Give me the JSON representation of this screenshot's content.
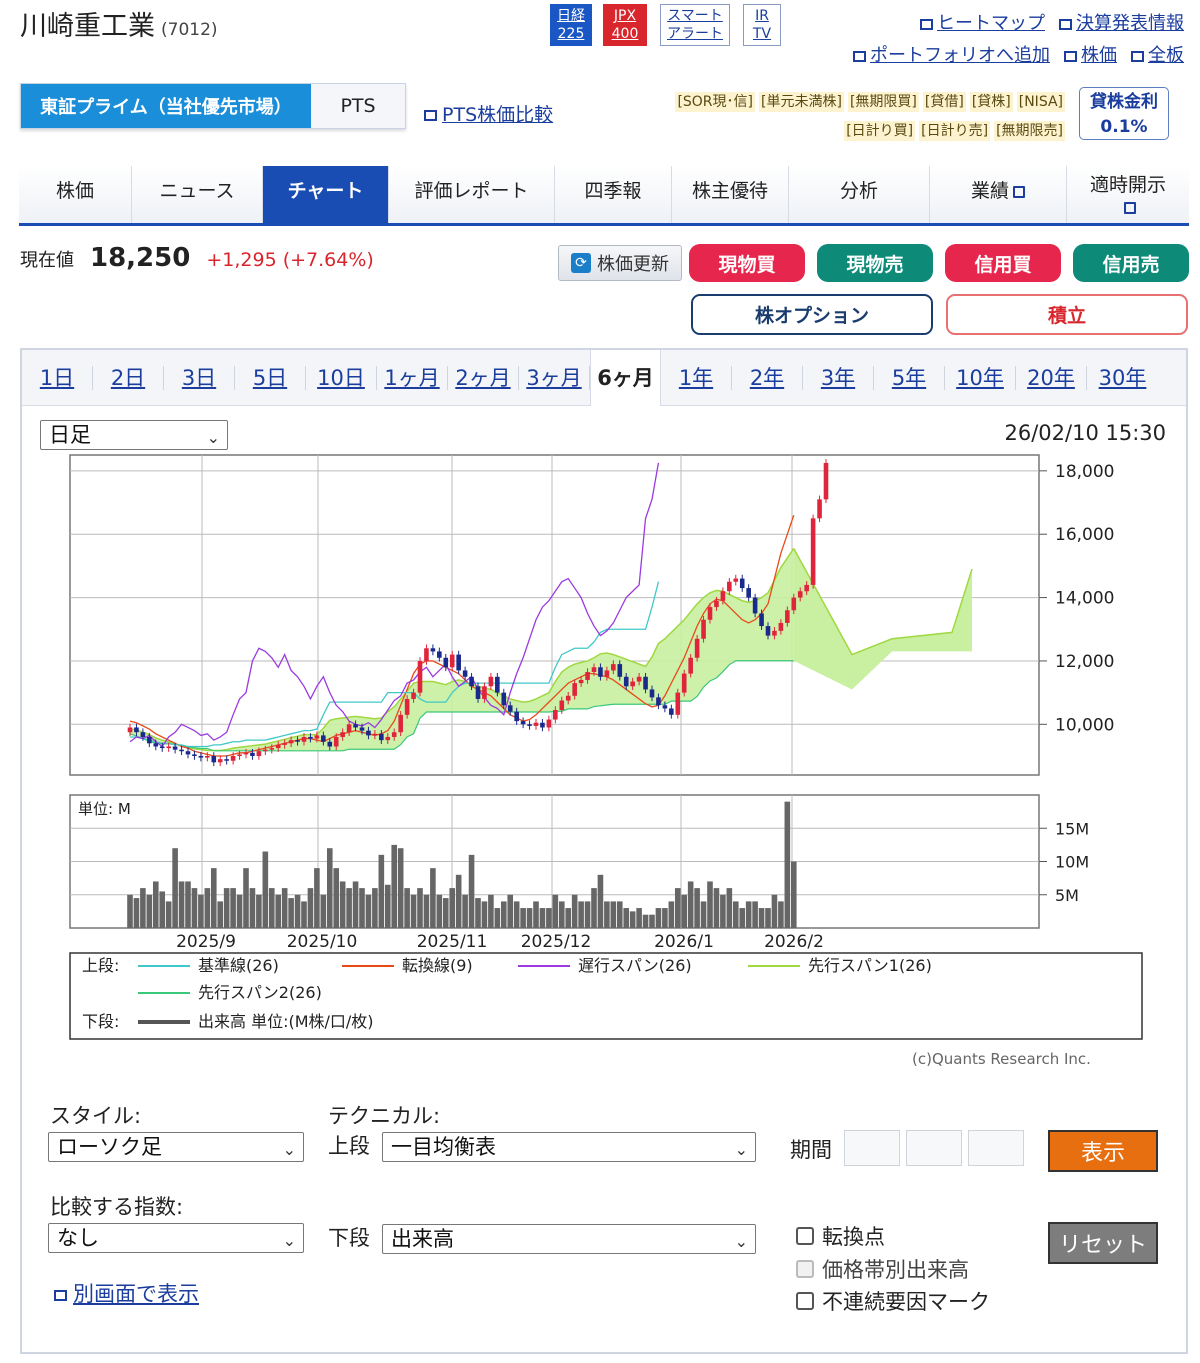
{
  "header": {
    "company_name": "川崎重工業",
    "code": "(7012)",
    "badges": [
      {
        "line1": "日経",
        "line2": "225"
      },
      {
        "line1": "JPX",
        "line2": "400"
      },
      {
        "line1": "スマート",
        "line2": "アラート"
      },
      {
        "line1": "IR",
        "line2": "TV"
      }
    ],
    "links_row1": [
      "ヒートマップ",
      "決算発表情報"
    ],
    "links_row2": [
      "ポートフォリオへ追加",
      "株価",
      "全板"
    ]
  },
  "market": {
    "active_tab": "東証プライム（当社優先市場）",
    "pts_tab": "PTS",
    "pts_compare": "PTS株価比較",
    "tags_row1": [
      "[SOR現･信]",
      "[単元未満株]",
      "[無期限買]",
      "[貸借]",
      "[貸株]",
      "[NISA]"
    ],
    "tags_row2": [
      "[日計り買]",
      "[日計り売]",
      "[無期限売]"
    ],
    "lending_label": "貸株金利",
    "lending_rate": "0.1%"
  },
  "nav": {
    "items": [
      {
        "label": "株価"
      },
      {
        "label": "ニュース"
      },
      {
        "label": "チャート",
        "active": true
      },
      {
        "label": "評価レポート"
      },
      {
        "label": "四季報"
      },
      {
        "label": "株主優待"
      },
      {
        "label": "分析"
      },
      {
        "label": "業績",
        "ext": true
      },
      {
        "label": "適時開示",
        "ext": true
      }
    ]
  },
  "price": {
    "label": "現在値",
    "value": "18,250",
    "change": "+1,295 (+7.64%)",
    "refresh_label": "株価更新",
    "buttons": [
      "現物買",
      "現物売",
      "信用買",
      "信用売"
    ],
    "option_label": "株オプション",
    "tsumitate_label": "積立"
  },
  "period_tabs": [
    "1日",
    "2日",
    "3日",
    "5日",
    "10日",
    "1ヶ月",
    "2ヶ月",
    "3ヶ月",
    "6ヶ月",
    "1年",
    "2年",
    "3年",
    "5年",
    "10年",
    "20年",
    "30年"
  ],
  "active_period": "6ヶ月",
  "chart_controls": {
    "interval": "日足",
    "timestamp": "26/02/10 15:30"
  },
  "chart_data": {
    "type": "candlestick",
    "y_ticks": [
      "18,000",
      "16,000",
      "14,000",
      "12,000",
      "10,000"
    ],
    "ylim": [
      8400,
      18500
    ],
    "x_labels": [
      "2025/9",
      "2025/10",
      "2025/11",
      "2025/12",
      "2026/1",
      "2026/2"
    ],
    "volume_unit": "単位: M",
    "volume_ticks": [
      "15M",
      "10M",
      "5M"
    ],
    "close": [
      9900,
      9750,
      9600,
      9400,
      9300,
      9250,
      9300,
      9200,
      9150,
      9050,
      9000,
      8950,
      9000,
      8800,
      8900,
      8850,
      9000,
      9050,
      9100,
      9000,
      9150,
      9200,
      9250,
      9350,
      9400,
      9500,
      9450,
      9600,
      9550,
      9650,
      9450,
      9300,
      9600,
      9750,
      10000,
      9900,
      9800,
      9650,
      9700,
      9500,
      9600,
      9750,
      10300,
      10800,
      11000,
      12000,
      12400,
      12300,
      12100,
      11800,
      12200,
      11700,
      11500,
      11200,
      10800,
      11200,
      11500,
      11000,
      10600,
      10400,
      10100,
      10000,
      9950,
      10050,
      9900,
      10150,
      10450,
      10750,
      10900,
      11300,
      11400,
      11650,
      11800,
      11500,
      11700,
      11900,
      11500,
      11200,
      11350,
      11500,
      11100,
      10850,
      10600,
      10500,
      10300,
      11000,
      11600,
      12100,
      12700,
      13300,
      13700,
      13900,
      14200,
      14500,
      14600,
      14300,
      14000,
      13500,
      13100,
      12800,
      12950,
      13200,
      13600,
      14000,
      14200,
      14400,
      16500,
      17100,
      18250
    ],
    "tenkan": [
      10100,
      10050,
      9950,
      9850,
      9700,
      9600,
      9500,
      9400,
      9300,
      9250,
      9150,
      9100,
      9050,
      9000,
      9000,
      9000,
      9050,
      9100,
      9100,
      9150,
      9200,
      9250,
      9300,
      9350,
      9400,
      9450,
      9500,
      9550,
      9550,
      9500,
      9450,
      9550,
      9650,
      9700,
      9750,
      9800,
      9750,
      9700,
      9650,
      9700,
      9800,
      10100,
      10600,
      11100,
      11600,
      11900,
      12000,
      12000,
      11900,
      11800,
      11700,
      11600,
      11400,
      11200,
      11100,
      11000,
      10900,
      10700,
      10500,
      10300,
      10200,
      10100,
      10150,
      10300,
      10500,
      10700,
      10900,
      11100,
      11300,
      11400,
      11500,
      11600,
      11600,
      11550,
      11500,
      11400,
      11250,
      11100,
      10950,
      10800,
      10650,
      10550,
      10600,
      10900,
      11300,
      11700,
      12100,
      12600,
      13100,
      13500,
      13800,
      13950,
      13900,
      13700,
      13500,
      13300,
      13200,
      13300,
      13500,
      13800,
      14600,
      15400,
      16000,
      16600
    ],
    "kijun": [
      9600,
      9600,
      9550,
      9500,
      9450,
      9400,
      9400,
      9350,
      9350,
      9300,
      9300,
      9300,
      9300,
      9350,
      9350,
      9400,
      9450,
      9450,
      9500,
      9500,
      9500,
      9500,
      9550,
      9600,
      9650,
      9700,
      9750,
      9800,
      9800,
      9850,
      10300,
      10700,
      10700,
      10700,
      10700,
      10700,
      10700,
      10700,
      10700,
      10700,
      11000,
      11000,
      11000,
      11000,
      11000,
      10800,
      10700,
      10700,
      10700,
      10700,
      11000,
      11200,
      11300,
      11300,
      11300,
      11300,
      11300,
      11300,
      11300,
      11300,
      11300,
      11300,
      11300,
      11300,
      11300,
      11300,
      11800,
      12200,
      12300,
      12400,
      12400,
      12400,
      12600,
      12900,
      13000,
      13000,
      13000,
      13000,
      13000,
      13000,
      13000,
      13700,
      14500
    ],
    "chikou_note": "遅行スパン(26)",
    "volumes": [
      5,
      4.5,
      6,
      5,
      7,
      5.5,
      4,
      12,
      7,
      7,
      6,
      5,
      6,
      9,
      4,
      6,
      6,
      5,
      9,
      6,
      5,
      11.5,
      6,
      5,
      6,
      4.5,
      5,
      4,
      6,
      9,
      5,
      12,
      9,
      7,
      6,
      7,
      6,
      5,
      6,
      11,
      6.5,
      12.5,
      12,
      6,
      5,
      6,
      5,
      9,
      5,
      4.5,
      6,
      8,
      5,
      11,
      4.5,
      4,
      5,
      3,
      4,
      5,
      4,
      3,
      3,
      4,
      3,
      3,
      5,
      4,
      3,
      5,
      4,
      4,
      6,
      8,
      4,
      4,
      4,
      3,
      2.5,
      3,
      2,
      2,
      3,
      3,
      4,
      6,
      5,
      7,
      6,
      4,
      7,
      6,
      5,
      6,
      4,
      3,
      4,
      4,
      3,
      3,
      5,
      4,
      19,
      10
    ]
  },
  "legend": {
    "upper_label": "上段:",
    "lower_label": "下段:",
    "items": [
      "基準線(26)",
      "転換線(9)",
      "遅行スパン(26)",
      "先行スパン1(26)",
      "先行スパン2(26)"
    ],
    "volume_item": "出来高 単位:(M株/口/枚)"
  },
  "copyright": "(c)Quants Research Inc.",
  "controls": {
    "style_label": "スタイル:",
    "style_value": "ローソク足",
    "compare_label": "比較する指数:",
    "compare_value": "なし",
    "technical_label": "テクニカル:",
    "upper_label": "上段",
    "upper_value": "一目均衡表",
    "lower_label": "下段",
    "lower_value": "出来高",
    "period_label": "期間",
    "show_button": "表示",
    "reset_button": "リセット",
    "checks": [
      "転換点",
      "価格帯別出来高",
      "不連続要因マーク"
    ],
    "new_window": "別画面で表示"
  },
  "colors": {
    "up": "#e0243c",
    "down": "#1a2a8c",
    "kijun": "#40c8c8",
    "tenkan": "#e84a1a",
    "chikou": "#9a3ae0",
    "span1": "#a0d840",
    "cloud": "#c8f0a0"
  }
}
